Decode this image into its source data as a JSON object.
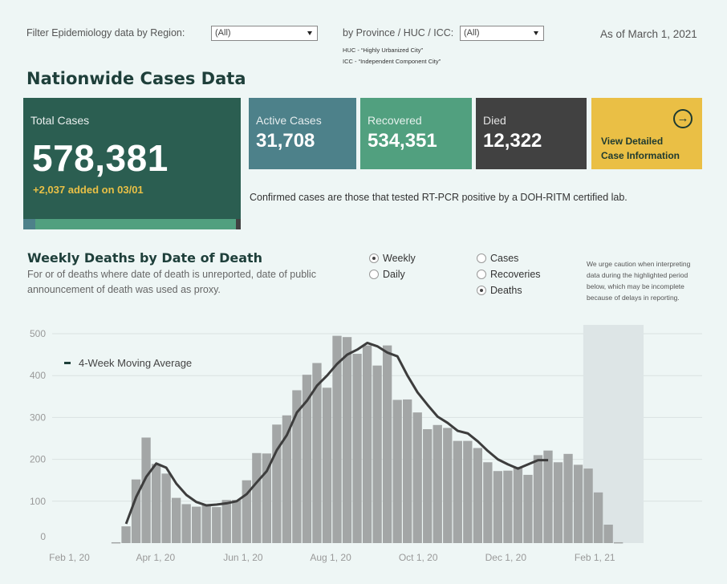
{
  "filters": {
    "region_label": "Filter Epidemiology data by Region:",
    "region_value": "(All)",
    "province_label": "by Province / HUC / ICC:",
    "province_value": "(All)",
    "huc_note": "HUC - “Highly Urbanized City”",
    "icc_note": "ICC - “Independent Component City”",
    "as_of": "As of March 1, 2021"
  },
  "page_title": "Nationwide Cases Data",
  "cards": {
    "total": {
      "label": "Total Cases",
      "value": "578,381",
      "added": "+2,037 added on 03/01"
    },
    "active": {
      "label": "Active Cases",
      "value": "31,708",
      "color": "#4d818a"
    },
    "recovered": {
      "label": "Recovered",
      "value": "534,351",
      "color": "#51a07f"
    },
    "died": {
      "label": "Died",
      "value": "12,322",
      "color": "#414141"
    },
    "detail": {
      "line1": "View Detailed",
      "line2": "Case Information",
      "icon": "arrow-right-circle-icon",
      "color": "#eabf45"
    },
    "composition": {
      "active": 31708,
      "recovered": 534351,
      "died": 12322
    }
  },
  "confirmed_note": "Confirmed cases are those that tested RT-PCR positive by a DOH-RITM certified lab.",
  "chart_section": {
    "title": "Weekly Deaths by Date of Death",
    "subtitle": "For  or  of deaths where date of death is unreported, date of public announcement of death was used as proxy.",
    "period_options": [
      {
        "label": "Weekly",
        "selected": true
      },
      {
        "label": "Daily",
        "selected": false
      }
    ],
    "metric_options": [
      {
        "label": "Cases",
        "selected": false
      },
      {
        "label": "Recoveries",
        "selected": false
      },
      {
        "label": "Deaths",
        "selected": true
      }
    ],
    "caution": "We urge caution when interpreting data during the highlighted period below, which may be incomplete because of delays in reporting."
  },
  "chart_data": {
    "type": "bar",
    "title": "Weekly Deaths by Date of Death",
    "xlabel": "",
    "ylabel": "",
    "ylim": [
      0,
      520
    ],
    "yticks": [
      0,
      100,
      200,
      300,
      400,
      500
    ],
    "grid": true,
    "x_start": "2020-03-01",
    "x_range": [
      "2020-01-20",
      "2021-03-31"
    ],
    "xtick_labels": [
      {
        "label": "Feb 1, 20",
        "date": "2020-02-01"
      },
      {
        "label": "Apr 1, 20",
        "date": "2020-04-01"
      },
      {
        "label": "Jun 1, 20",
        "date": "2020-06-01"
      },
      {
        "label": "Aug 1, 20",
        "date": "2020-08-01"
      },
      {
        "label": "Oct 1, 20",
        "date": "2020-10-01"
      },
      {
        "label": "Dec 1, 20",
        "date": "2020-12-01"
      },
      {
        "label": "Feb 1, 21",
        "date": "2021-02-01"
      }
    ],
    "legend": {
      "label": "4-Week Moving Average",
      "position": "top-left"
    },
    "highlight_period": [
      "2021-01-24",
      "2021-03-07"
    ],
    "series": [
      {
        "name": "Weekly Deaths",
        "type": "bar",
        "color": "#a3a6a6",
        "values": [
          2,
          40,
          152,
          252,
          189,
          166,
          108,
          93,
          87,
          90,
          86,
          103,
          103,
          150,
          215,
          214,
          283,
          305,
          365,
          402,
          430,
          371,
          495,
          492,
          452,
          472,
          424,
          472,
          342,
          343,
          312,
          272,
          282,
          275,
          244,
          244,
          227,
          193,
          172,
          173,
          182,
          163,
          210,
          221,
          193,
          213,
          187,
          178,
          121,
          44,
          2
        ]
      },
      {
        "name": "4-Week Moving Average",
        "type": "line",
        "color": "#3d3d3d",
        "start_index": 1,
        "values": [
          46,
          110,
          158,
          190,
          180,
          142,
          115,
          98,
          90,
          92,
          95,
          100,
          117,
          145,
          172,
          222,
          258,
          312,
          340,
          376,
          400,
          428,
          450,
          462,
          478,
          470,
          455,
          446,
          400,
          360,
          330,
          302,
          287,
          268,
          262,
          243,
          220,
          200,
          188,
          178,
          188,
          198,
          198
        ]
      }
    ]
  }
}
